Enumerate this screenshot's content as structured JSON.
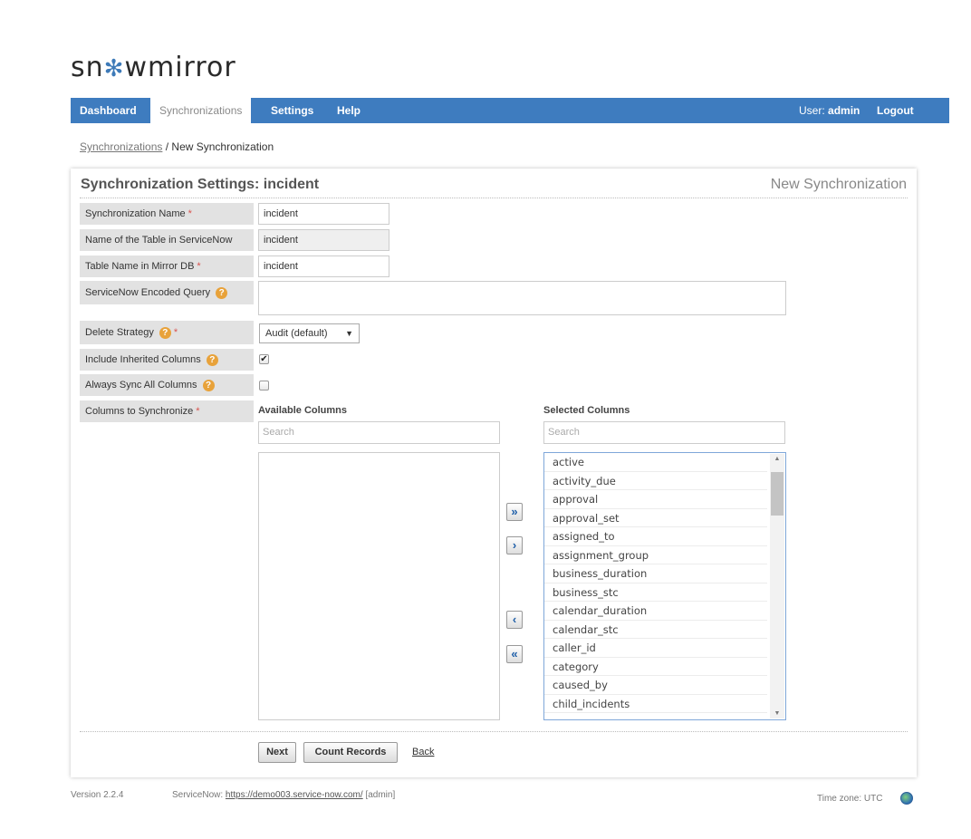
{
  "logo": {
    "part1": "sn",
    "flake": "✻",
    "part2": "wmirror"
  },
  "nav": {
    "items": [
      "Dashboard",
      "Synchronizations",
      "Settings",
      "Help"
    ],
    "user_prefix": "User:",
    "user_name": "admin",
    "logout": "Logout"
  },
  "breadcrumb": {
    "link": "Synchronizations",
    "separator": " / ",
    "current": "New Synchronization"
  },
  "panel": {
    "title": "Synchronization Settings: incident",
    "right_title": "New Synchronization"
  },
  "form": {
    "sync_name_label": "Synchronization Name",
    "sync_name_value": "incident",
    "table_sn_label": "Name of the Table in ServiceNow",
    "table_sn_value": "incident",
    "table_mirror_label": "Table Name in Mirror DB",
    "table_mirror_value": "incident",
    "encoded_query_label": "ServiceNow Encoded Query",
    "encoded_query_value": "",
    "delete_strategy_label": "Delete Strategy",
    "delete_strategy_value": "Audit (default)",
    "include_inherited_label": "Include Inherited Columns",
    "include_inherited_checked": true,
    "always_sync_label": "Always Sync All Columns",
    "always_sync_checked": false,
    "columns_label": "Columns to Synchronize",
    "required_mark": "*",
    "help_mark": "?"
  },
  "columns": {
    "available_header": "Available Columns",
    "selected_header": "Selected Columns",
    "available_search_placeholder": "Search",
    "selected_search_placeholder": "Search",
    "available": [],
    "selected": [
      "active",
      "activity_due",
      "approval",
      "approval_set",
      "assigned_to",
      "assignment_group",
      "business_duration",
      "business_stc",
      "calendar_duration",
      "calendar_stc",
      "caller_id",
      "category",
      "caused_by",
      "child_incidents"
    ],
    "move_all_right": "»",
    "move_right": "›",
    "move_left": "‹",
    "move_all_left": "«"
  },
  "buttons": {
    "next": "Next",
    "count_records": "Count Records",
    "back": "Back"
  },
  "footer": {
    "version": "Version 2.2.4",
    "servicenow_prefix": "ServiceNow:",
    "servicenow_url": "https://demo003.service-now.com/",
    "servicenow_user": "[admin]",
    "timezone": "Time zone: UTC"
  },
  "colors": {
    "nav_bg": "#3e7cbf",
    "label_bg": "#e2e2e2",
    "required": "#d9534f",
    "help": "#e8a23a"
  }
}
